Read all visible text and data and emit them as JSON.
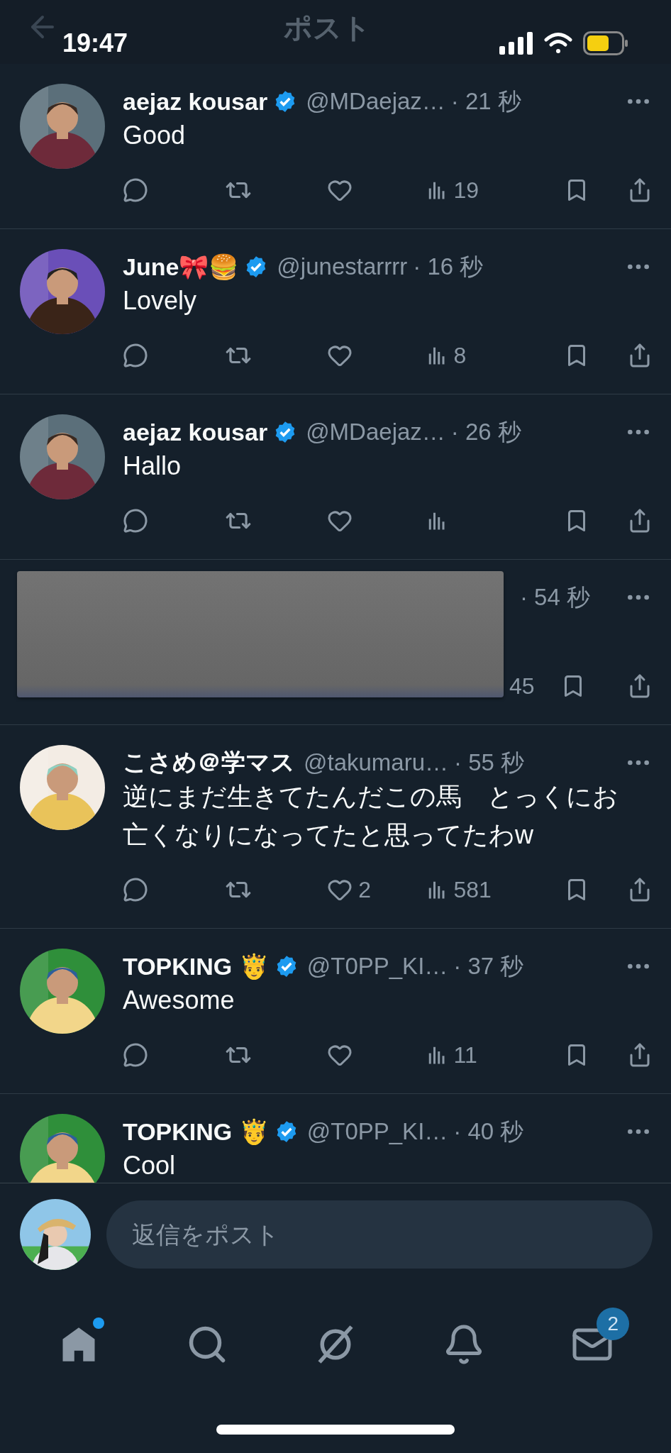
{
  "status_bar": {
    "time": "19:47"
  },
  "header": {
    "title": "ポスト"
  },
  "posts": [
    {
      "name": "aejaz kousar",
      "verified": true,
      "handle": "@MDaejaz…",
      "time": "· 21 秒",
      "text": "Good",
      "views": "19"
    },
    {
      "name": "June🎀🍔",
      "verified": true,
      "handle": "@junestarrrr",
      "time": "· 16 秒",
      "text": "Lovely",
      "views": "8"
    },
    {
      "name": "aejaz kousar",
      "verified": true,
      "handle": "@MDaejaz…",
      "time": "· 26 秒",
      "text": "Hallo"
    },
    {
      "redacted": true,
      "time": "· 54 秒",
      "views": "45"
    },
    {
      "name": "こさめ＠学マス",
      "verified": false,
      "handle": "@takumaru…",
      "time": "· 55 秒",
      "text": "逆にまだ生きてたんだこの馬　とっくにお亡くなりになってたと思ってたわw",
      "likes": "2",
      "views": "581"
    },
    {
      "name": "TOPKING 🤴",
      "verified": true,
      "handle": "@T0PP_KI…",
      "time": "· 37 秒",
      "text": "Awesome",
      "views": "11"
    },
    {
      "name": "TOPKING 🤴",
      "verified": true,
      "handle": "@T0PP_KI…",
      "time": "· 40 秒",
      "text": "Cool",
      "cut": true
    }
  ],
  "reply": {
    "placeholder": "返信をポスト"
  },
  "nav": [
    {
      "kind": "home",
      "dot": true
    },
    {
      "kind": "search"
    },
    {
      "kind": "grok"
    },
    {
      "kind": "notifications"
    },
    {
      "kind": "messages",
      "badge": "2"
    }
  ]
}
